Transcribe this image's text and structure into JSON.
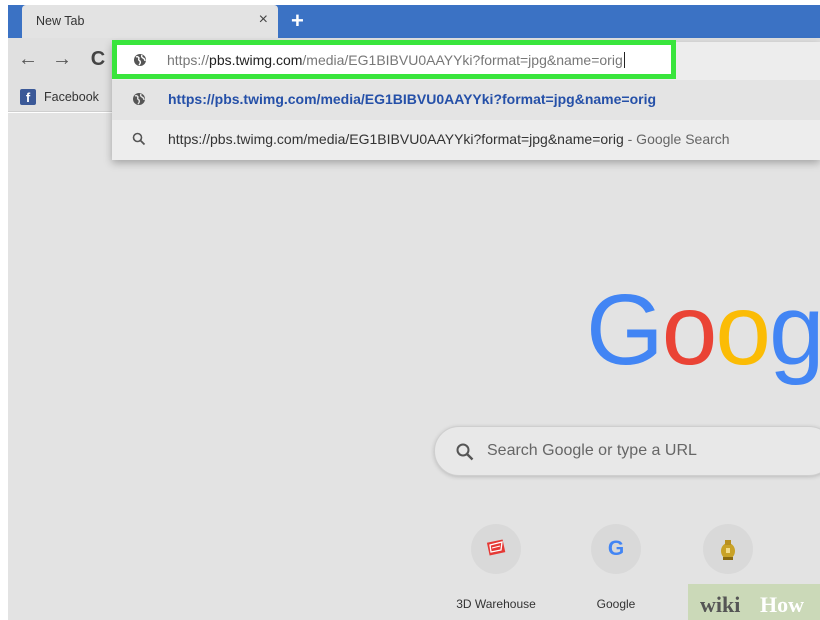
{
  "tab": {
    "title": "New Tab",
    "close_glyph": "×"
  },
  "new_tab_glyph": "+",
  "toolbar": {
    "back_glyph": "←",
    "forward_glyph": "→",
    "reload_glyph": "C"
  },
  "bookmarks": [
    {
      "label": "Facebook",
      "icon": "facebook-icon"
    }
  ],
  "omnibox": {
    "scheme": "https://",
    "host": "pbs.twimg.com",
    "path": "/media/EG1BIBVU0AAYYki?format=jpg&name=orig",
    "icon": "globe-icon"
  },
  "suggestions": [
    {
      "icon": "globe-icon",
      "text": "https://pbs.twimg.com/media/EG1BIBVU0AAYYki?format=jpg&name=orig"
    },
    {
      "icon": "search-icon",
      "text": "https://pbs.twimg.com/media/EG1BIBVU0AAYYki?format=jpg&name=orig",
      "suffix": " - Google Search"
    }
  ],
  "logo": {
    "letters": [
      "G",
      "o",
      "o",
      "g"
    ],
    "colors": [
      "#4285f4",
      "#ea4335",
      "#fbbc05",
      "#4285f4"
    ]
  },
  "search": {
    "placeholder": "Search Google or type a URL",
    "icon": "search-icon"
  },
  "shortcuts": [
    {
      "label": "3D Warehouse",
      "icon": "3d-warehouse-icon"
    },
    {
      "label": "Google",
      "icon": "google-icon",
      "glyph": "G"
    },
    {
      "label": "",
      "icon": "bank-icon"
    }
  ],
  "watermark": {
    "wiki": "wiki",
    "how": "How"
  },
  "colors": {
    "highlight": "#39e53c",
    "tabstrip": "#3b72c4",
    "link": "#2550a8"
  }
}
